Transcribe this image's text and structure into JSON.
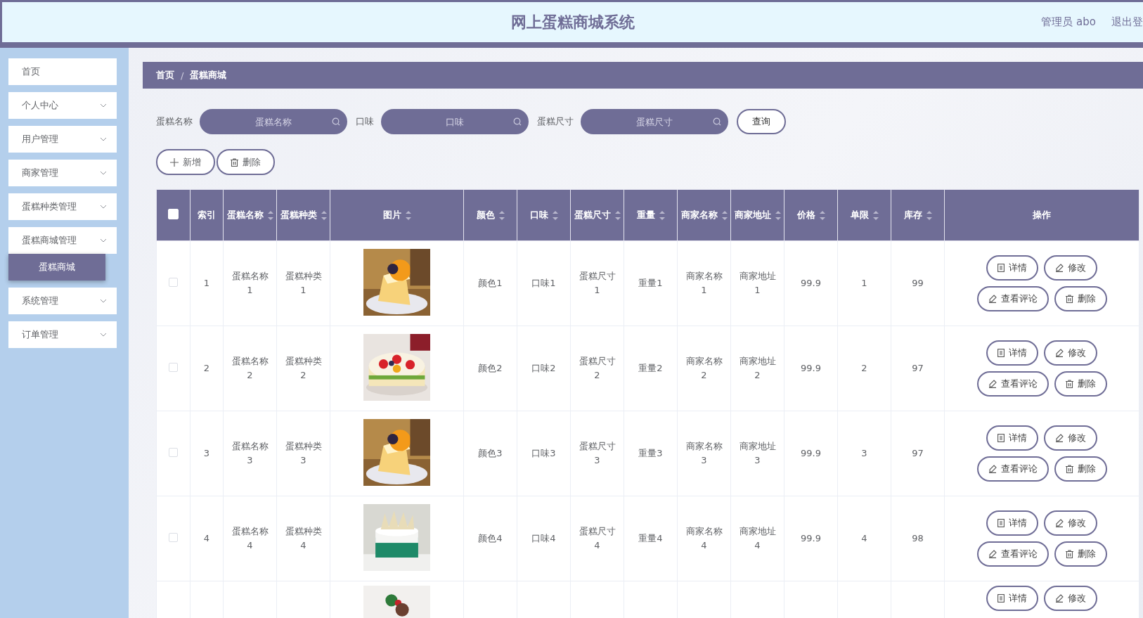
{
  "header": {
    "title": "网上蛋糕商城系统",
    "user": "管理员 abo",
    "logout": "退出登"
  },
  "sidebar": {
    "items": [
      {
        "kind": "link",
        "label": "首页"
      },
      {
        "kind": "group",
        "label": "个人中心"
      },
      {
        "kind": "group",
        "label": "用户管理"
      },
      {
        "kind": "group",
        "label": "商家管理"
      },
      {
        "kind": "group",
        "label": "蛋糕种类管理"
      },
      {
        "kind": "group",
        "label": "蛋糕商城管理",
        "expanded": true,
        "children": [
          {
            "label": "蛋糕商城",
            "selected": true
          }
        ]
      },
      {
        "kind": "group",
        "label": "系统管理"
      },
      {
        "kind": "group",
        "label": "订单管理"
      }
    ]
  },
  "breadcrumb": {
    "items": [
      "首页",
      "蛋糕商城"
    ],
    "separator": "/"
  },
  "search": {
    "fields": [
      {
        "label": "蛋糕名称",
        "placeholder": "蛋糕名称"
      },
      {
        "label": "口味",
        "placeholder": "口味"
      },
      {
        "label": "蛋糕尺寸",
        "placeholder": "蛋糕尺寸"
      }
    ],
    "button": "查询"
  },
  "toolbar": [
    {
      "kind": "add",
      "label": "新增"
    },
    {
      "kind": "delete",
      "label": "删除"
    }
  ],
  "table": {
    "select_all": {
      "checked": false
    },
    "columns": [
      {
        "label": "索引",
        "sortable": false
      },
      {
        "label": "蛋糕名称",
        "sortable": true
      },
      {
        "label": "蛋糕种类",
        "sortable": true
      },
      {
        "label": "图片",
        "sortable": true
      },
      {
        "label": "颜色",
        "sortable": true
      },
      {
        "label": "口味",
        "sortable": true
      },
      {
        "label": "蛋糕尺寸",
        "sortable": true
      },
      {
        "label": "重量",
        "sortable": true
      },
      {
        "label": "商家名称",
        "sortable": true
      },
      {
        "label": "商家地址",
        "sortable": true
      },
      {
        "label": "价格",
        "sortable": true
      },
      {
        "label": "单限",
        "sortable": true
      },
      {
        "label": "库存",
        "sortable": true
      },
      {
        "label": "操作",
        "sortable": false
      }
    ],
    "rows": [
      {
        "checked": false,
        "cells": [
          "1",
          "蛋糕名称1",
          "蛋糕种类1",
          "",
          "颜色1",
          "口味1",
          "蛋糕尺寸1",
          "重量1",
          "商家名称1",
          "商家地址1",
          "99.9",
          "1",
          "99"
        ],
        "actions": [
          {
            "kind": "detail",
            "label": "详情"
          },
          {
            "kind": "edit",
            "label": "修改"
          },
          {
            "kind": "edit",
            "label": "查看评论"
          },
          {
            "kind": "delete",
            "label": "删除"
          }
        ]
      },
      {
        "checked": false,
        "cells": [
          "2",
          "蛋糕名称2",
          "蛋糕种类2",
          "",
          "颜色2",
          "口味2",
          "蛋糕尺寸2",
          "重量2",
          "商家名称2",
          "商家地址2",
          "99.9",
          "2",
          "97"
        ],
        "actions": [
          {
            "kind": "detail",
            "label": "详情"
          },
          {
            "kind": "edit",
            "label": "修改"
          },
          {
            "kind": "edit",
            "label": "查看评论"
          },
          {
            "kind": "delete",
            "label": "删除"
          }
        ]
      },
      {
        "checked": false,
        "cells": [
          "3",
          "蛋糕名称3",
          "蛋糕种类3",
          "",
          "颜色3",
          "口味3",
          "蛋糕尺寸3",
          "重量3",
          "商家名称3",
          "商家地址3",
          "99.9",
          "3",
          "97"
        ],
        "actions": [
          {
            "kind": "detail",
            "label": "详情"
          },
          {
            "kind": "edit",
            "label": "修改"
          },
          {
            "kind": "edit",
            "label": "查看评论"
          },
          {
            "kind": "delete",
            "label": "删除"
          }
        ]
      },
      {
        "checked": false,
        "cells": [
          "4",
          "蛋糕名称4",
          "蛋糕种类4",
          "",
          "颜色4",
          "口味4",
          "蛋糕尺寸4",
          "重量4",
          "商家名称4",
          "商家地址4",
          "99.9",
          "4",
          "98"
        ],
        "actions": [
          {
            "kind": "detail",
            "label": "详情"
          },
          {
            "kind": "edit",
            "label": "修改"
          },
          {
            "kind": "edit",
            "label": "查看评论"
          },
          {
            "kind": "delete",
            "label": "删除"
          }
        ]
      },
      {
        "cells": [],
        "actions": [
          {
            "kind": "detail",
            "label": "详情"
          },
          {
            "kind": "edit",
            "label": "修改"
          }
        ]
      }
    ]
  }
}
